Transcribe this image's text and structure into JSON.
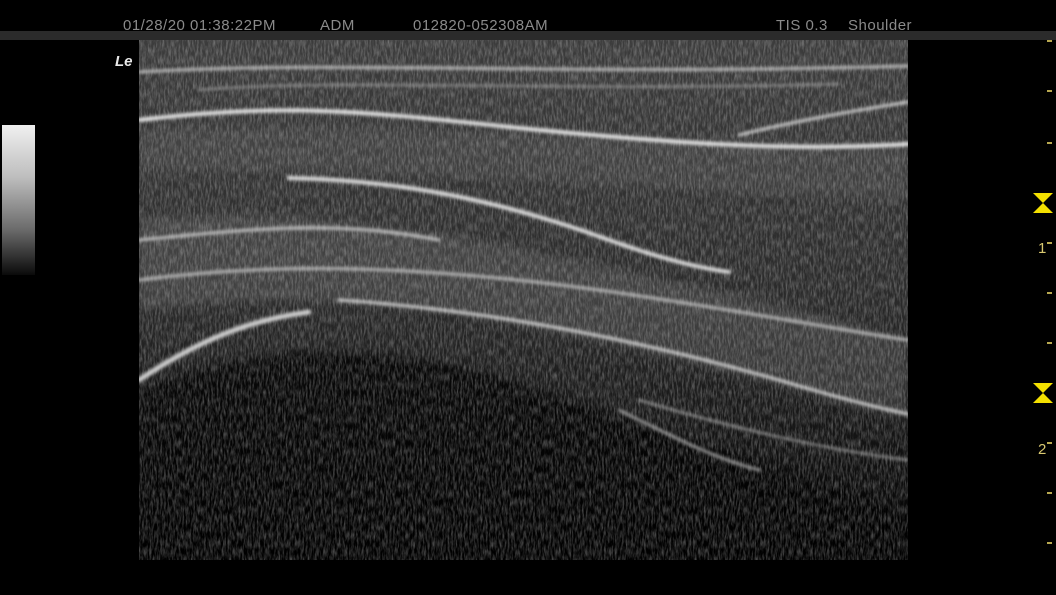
{
  "header": {
    "datetime": "01/28/20 01:38:22PM",
    "operator": "ADM",
    "patient_id": "012820-052308AM",
    "preset": "TIS 0.3",
    "exam": "Shoulder"
  },
  "image": {
    "orientation_label": "Le",
    "modality": "B-mode ultrasound"
  },
  "depth_scale": {
    "labels": [
      "1",
      "2"
    ],
    "unit": "cm"
  },
  "colors": {
    "background": "#000000",
    "marker": "#f4e000",
    "scale_text": "#d8c870"
  },
  "icons": [
    "focus-marker-icon",
    "focal-zone-icon",
    "grayscale-bar"
  ]
}
